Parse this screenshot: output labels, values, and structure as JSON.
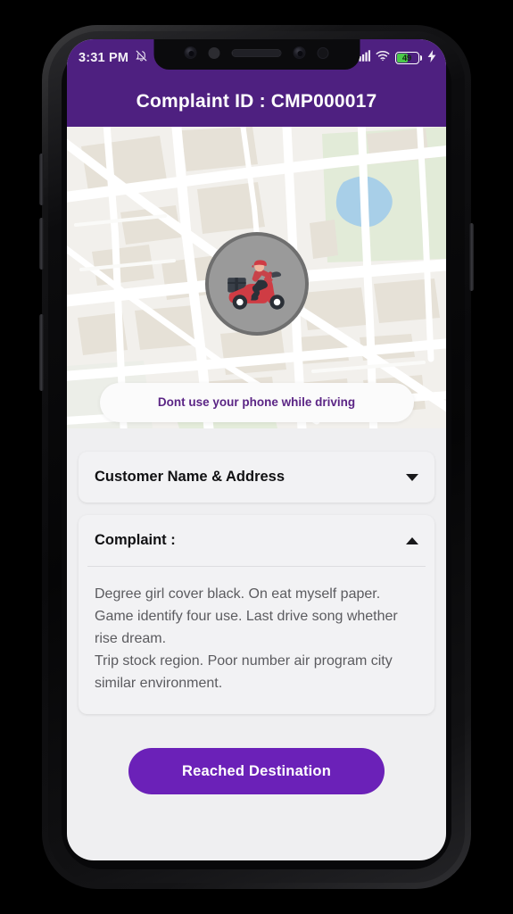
{
  "status_bar": {
    "time": "3:31 PM",
    "icons_left": [
      "bell-off-icon",
      "moon-dnd-icon"
    ],
    "icons_right": [
      "signal-icon",
      "wifi-icon",
      "battery-icon",
      "charging-bolt-icon"
    ],
    "battery_percent": "49",
    "battery_level": 49,
    "charging": true
  },
  "header": {
    "title": "Complaint ID : CMP000017",
    "background_color": "#4e2080",
    "text_color": "#ffffff"
  },
  "map": {
    "rider_icon": "delivery-scooter-icon",
    "colors": {
      "base": "#f2f0ec",
      "road": "#ffffff",
      "block": "#e6e1d7",
      "park": "#dfe8d5",
      "water": "#a8cfe8"
    }
  },
  "warning": {
    "text": "Dont use your phone while driving",
    "text_color": "#5b2585"
  },
  "cards": [
    {
      "title": "Customer Name & Address",
      "expanded": false,
      "caret_icon": "chevron-down-icon",
      "lines": []
    },
    {
      "title": "Complaint :",
      "expanded": true,
      "caret_icon": "chevron-up-icon",
      "lines": [
        "Degree girl cover black. On eat myself paper.",
        "Game identify four use. Last drive song whether rise dream.",
        "Trip stock region. Poor number air program city similar environment."
      ]
    }
  ],
  "action": {
    "label": "Reached Destination",
    "color": "#6b21b8"
  }
}
